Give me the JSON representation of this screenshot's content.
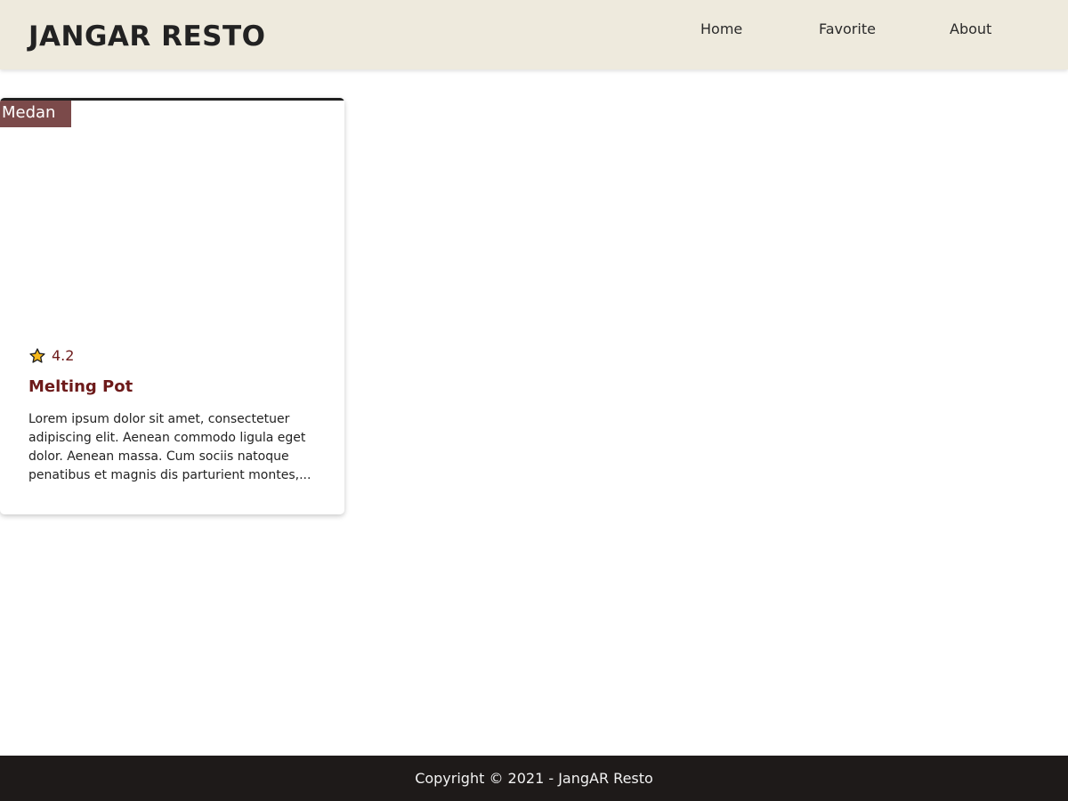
{
  "header": {
    "brand": "JANGAR RESTO",
    "nav": [
      {
        "label": "Home"
      },
      {
        "label": "Favorite"
      },
      {
        "label": "About"
      }
    ],
    "background_color": "#eeeadd"
  },
  "restaurants": [
    {
      "city": "Medan",
      "rating": "4.2",
      "rating_icon": "star-icon",
      "name": "Melting Pot",
      "description_lines": [
        "Lorem ipsum dolor sit amet, consectetuer",
        "adipiscing elit. Aenean commodo ligula eget",
        "dolor. Aenean massa. Cum sociis natoque",
        "penatibus et magnis dis parturient montes,..."
      ],
      "badge_color": "#7b4a4a",
      "accent_color": "#6d1a1a"
    }
  ],
  "footer": {
    "copyright": "Copyright © 2021 - JangAR Resto",
    "background_color": "#1e1a19"
  }
}
